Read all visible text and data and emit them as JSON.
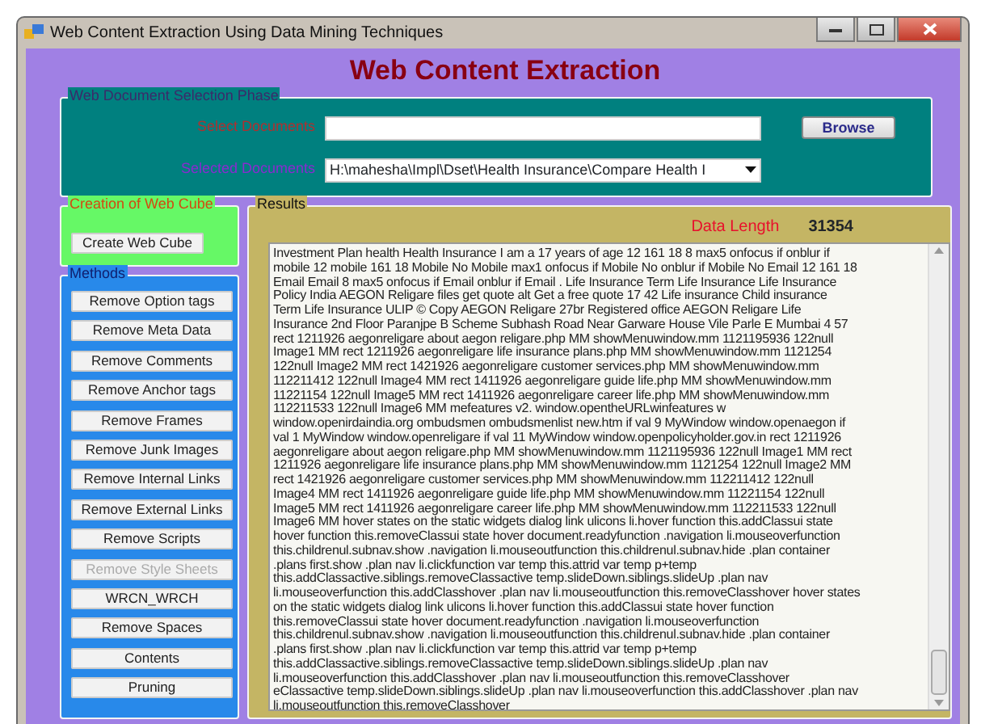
{
  "window": {
    "title": "Web Content Extraction Using Data Mining Techniques"
  },
  "header": "Web Content Extraction",
  "selection_phase": {
    "legend": "Web Document Selection Phase",
    "select_label": "Select Documents",
    "browse_button": "Browse",
    "selected_label": "Selected Documents",
    "selected_value": "H:\\mahesha\\Impl\\Dset\\Health Insurance\\Compare Health I"
  },
  "web_cube": {
    "legend": "Creation of Web Cube",
    "button": "Create Web Cube"
  },
  "methods": {
    "legend": "Methods",
    "buttons": [
      {
        "label": "Remove Option tags",
        "disabled": false
      },
      {
        "label": "Remove Meta Data",
        "disabled": false
      },
      {
        "label": "Remove Comments",
        "disabled": false
      },
      {
        "label": "Remove Anchor tags",
        "disabled": false
      },
      {
        "label": "Remove Frames",
        "disabled": false
      },
      {
        "label": "Remove Junk Images",
        "disabled": false
      },
      {
        "label": "Remove Internal Links",
        "disabled": false
      },
      {
        "label": "Remove External Links",
        "disabled": false
      },
      {
        "label": "Remove Scripts",
        "disabled": false
      },
      {
        "label": "Remove Style Sheets",
        "disabled": true
      },
      {
        "label": "WRCN_WRCH",
        "disabled": false
      },
      {
        "label": "Remove Spaces",
        "disabled": false
      },
      {
        "label": "Contents",
        "disabled": false
      },
      {
        "label": "Pruning",
        "disabled": false
      }
    ]
  },
  "results": {
    "legend": "Results",
    "data_length_label": "Data Length",
    "data_length_value": "31354",
    "lines": [
      "Investment Plan health Health Insurance I am a 17 years of age 12 161 18 8 max5 onfocus if onblur if",
      "mobile 12 mobile 161 18 Mobile No Mobile max1 onfocus if Mobile No onblur if Mobile No Email 12 161 18",
      "Email Email 8 max5 onfocus if Email onblur if Email . Life Insurance Term Life Insurance Life Insurance",
      "Policy India AEGON Religare files get quote alt Get a free quote 17 42 Life insurance Child insurance",
      "Term Life Insurance ULIP © Copy AEGON Religare 27br Registered office AEGON Religare Life",
      "Insurance 2nd Floor Paranjpe B Scheme Subhash Road Near Garware House Vile Parle E Mumbai 4 57",
      "rect 1211926 aegonreligare about aegon religare.php MM showMenuwindow.mm 1121195936 122null",
      "Image1 MM rect 1211926 aegonreligare life insurance plans.php MM showMenuwindow.mm 1121254",
      "122null Image2 MM rect 1421926 aegonreligare customer services.php MM showMenuwindow.mm",
      "112211412 122null Image4 MM rect 1411926 aegonreligare guide life.php MM showMenuwindow.mm",
      "11221154 122null Image5 MM rect 1411926 aegonreligare career life.php MM showMenuwindow.mm",
      "112211533 122null Image6 MM mefeatures v2. window.opentheURLwinfeatures w",
      "window.openirdaindia.org ombudsmen ombudsmenlist new.htm if val 9 MyWindow window.openaegon if",
      "val 1 MyWindow window.openreligare if val 11 MyWindow window.openpolicyholder.gov.in rect 1211926",
      "aegonreligare about aegon religare.php MM showMenuwindow.mm 1121195936 122null Image1 MM rect",
      "1211926 aegonreligare life insurance plans.php MM showMenuwindow.mm 1121254 122null Image2 MM",
      "rect 1421926 aegonreligare customer services.php MM showMenuwindow.mm 112211412 122null",
      "Image4 MM rect 1411926 aegonreligare guide life.php MM showMenuwindow.mm 11221154 122null",
      "Image5 MM rect 1411926 aegonreligare career life.php MM showMenuwindow.mm 112211533 122null",
      "Image6 MM hover states on the static widgets dialog link ulicons li.hover function this.addClassui state",
      "hover function this.removeClassui state hover document.readyfunction .navigation li.mouseoverfunction",
      "this.childrenul.subnav.show .navigation li.mouseoutfunction this.childrenul.subnav.hide .plan container",
      ".plans first.show .plan nav li.clickfunction var temp this.attrid var temp p+temp",
      "this.addClassactive.siblings.removeClassactive temp.slideDown.siblings.slideUp .plan nav",
      "li.mouseoverfunction this.addClasshover .plan nav li.mouseoutfunction this.removeClasshover hover states",
      "on the static widgets dialog link ulicons li.hover function this.addClassui state hover function",
      "this.removeClassui state hover document.readyfunction .navigation li.mouseoverfunction",
      "this.childrenul.subnav.show .navigation li.mouseoutfunction this.childrenul.subnav.hide .plan container",
      ".plans first.show .plan nav li.clickfunction var temp this.attrid var temp p+temp",
      "this.addClassactive.siblings.removeClassactive temp.slideDown.siblings.slideUp .plan nav",
      "li.mouseoverfunction this.addClasshover .plan nav li.mouseoutfunction this.removeClasshover",
      "eClassactive temp.slideDown.siblings.slideUp .plan nav li.mouseoverfunction this.addClasshover .plan nav",
      "li.mouseoutfunction this.removeClasshover"
    ]
  }
}
